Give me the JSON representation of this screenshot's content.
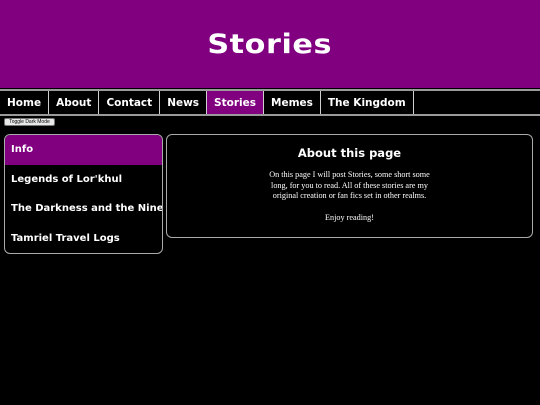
{
  "header": {
    "title": "Stories"
  },
  "nav": {
    "items": [
      {
        "label": "Home"
      },
      {
        "label": "About"
      },
      {
        "label": "Contact"
      },
      {
        "label": "News"
      },
      {
        "label": "Stories",
        "active": true
      },
      {
        "label": "Memes"
      },
      {
        "label": "The Kingdom"
      }
    ]
  },
  "toggle": {
    "label": "Toggle Dark Mode"
  },
  "sidebar": {
    "items": [
      {
        "label": "Info",
        "active": true
      },
      {
        "label": "Legends of Lor'khul"
      },
      {
        "label": "The Darkness and the Nine"
      },
      {
        "label": "Tamriel Travel Logs"
      }
    ]
  },
  "content": {
    "heading": "About this page",
    "body": "On this page I will post Stories, some short some long, for you to read. All of these stories are my original creation or fan fics set in other realms.",
    "closing": "Enjoy reading!"
  },
  "colors": {
    "accent": "#800080",
    "background": "#000000",
    "text": "#ffffff"
  }
}
